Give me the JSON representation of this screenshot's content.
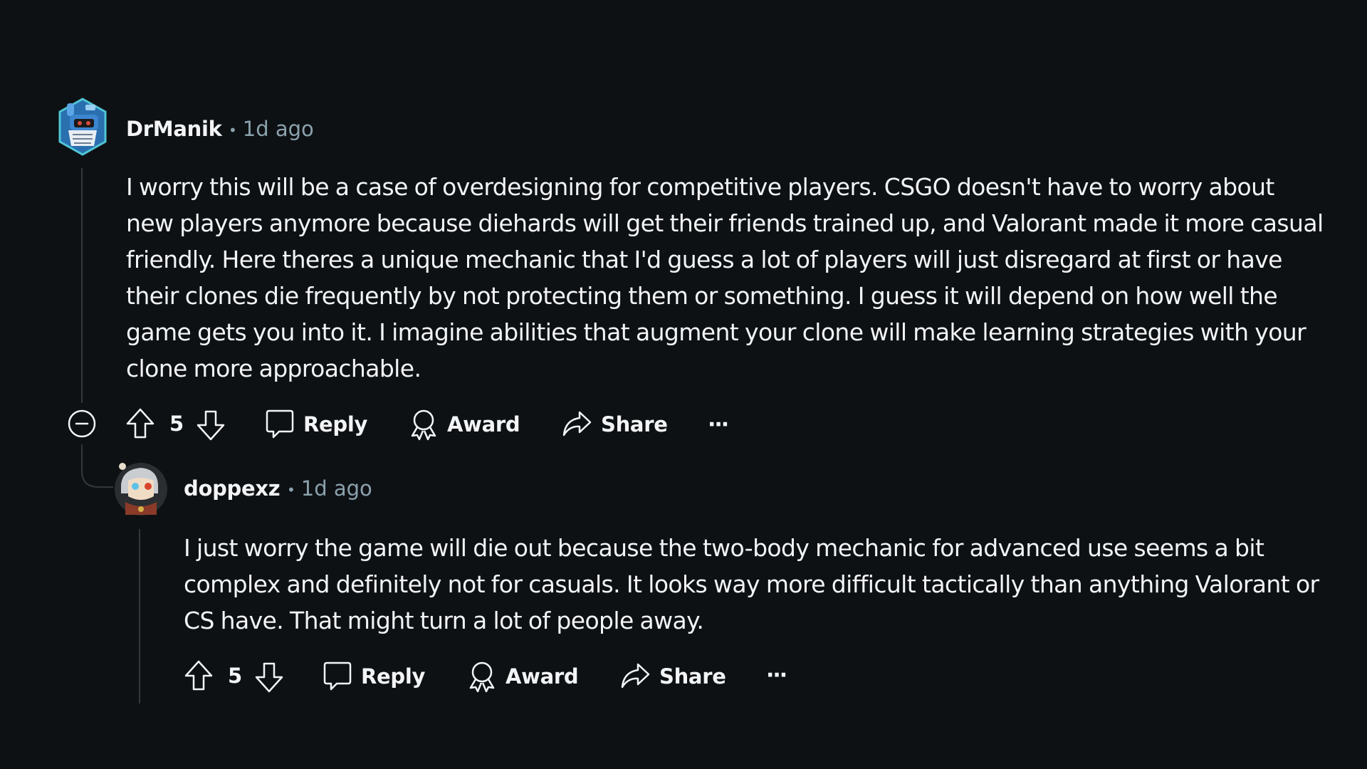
{
  "comments": [
    {
      "author": "DrManik",
      "separator": "•",
      "timestamp": "1d ago",
      "body_lines": [
        "I worry this will be a case of overdesigning for competitive players. CSGO doesn't have to worry about",
        "new players anymore because diehards will get their friends trained up, and Valorant made it more casual",
        "friendly. Here theres a unique mechanic that I'd guess a lot of players will just disregard at first or have",
        "their clones die frequently by not protecting them or something. I guess it will depend on how well the",
        "game gets you into it. I imagine abilities that augment your clone will make learning strategies with your",
        "clone more approachable."
      ],
      "score": "5",
      "actions": {
        "reply": "Reply",
        "award": "Award",
        "share": "Share",
        "more": "···"
      },
      "icons": [
        "collapse-icon",
        "upvote-icon",
        "downvote-icon",
        "comment-icon",
        "award-icon",
        "share-icon",
        "more-icon"
      ]
    },
    {
      "author": "doppexz",
      "separator": "•",
      "timestamp": "1d ago",
      "body_lines": [
        "I just worry the game will die out because the two-body mechanic for advanced use seems a bit",
        "complex and definitely not for casuals. It looks way more difficult tactically than anything Valorant or",
        "CS have. That might turn a lot of people away."
      ],
      "score": "5",
      "actions": {
        "reply": "Reply",
        "award": "Award",
        "share": "Share",
        "more": "···"
      },
      "icons": [
        "upvote-icon",
        "downvote-icon",
        "comment-icon",
        "award-icon",
        "share-icon",
        "more-icon"
      ]
    }
  ],
  "colors": {
    "background": "#0e1114",
    "text": "#f2f4f5",
    "meta": "#8ba2ad",
    "thread_line": "#33383c"
  }
}
